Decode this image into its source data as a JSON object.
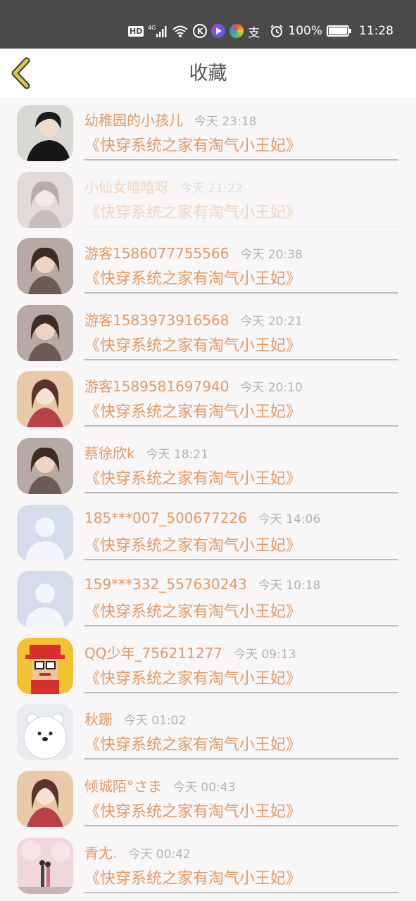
{
  "status_bar": {
    "hd": "HD",
    "network": "4G",
    "k_icon": "K",
    "alipay": "支",
    "battery_percent": "100%",
    "battery_level": 1.0,
    "time": "11:28"
  },
  "header": {
    "title": "收藏",
    "back_icon": "chevron-left-icon"
  },
  "colors": {
    "accent": "#e39a66",
    "header_bg": "#4a4a4a",
    "back_icon": "#e2c23f"
  },
  "favorites": [
    {
      "name": "幼稚园的小孩儿",
      "time": "今天 23:18",
      "book": "《快穿系统之家有淘气小王妃》",
      "avatar": "dark-hair-boy-avatar"
    },
    {
      "name": "小仙女嘻嘻呀",
      "time": "今天 21:22",
      "book": "《快穿系统之家有淘气小王妃》",
      "avatar": "girl-avatar"
    },
    {
      "name": "游客1586077755566",
      "time": "今天 20:38",
      "book": "《快穿系统之家有淘气小王妃》",
      "avatar": "girl-avatar"
    },
    {
      "name": "游客1583973916568",
      "time": "今天 20:21",
      "book": "《快穿系统之家有淘气小王妃》",
      "avatar": "girl-avatar"
    },
    {
      "name": "游客1589581697940",
      "time": "今天 20:10",
      "book": "《快穿系统之家有淘气小王妃》",
      "avatar": "anime-girl-avatar"
    },
    {
      "name": "蔡徐欣k",
      "time": "今天 18:21",
      "book": "《快穿系统之家有淘气小王妃》",
      "avatar": "girl-avatar"
    },
    {
      "name": "185***007_500677226",
      "time": "今天 14:06",
      "book": "《快穿系统之家有淘气小王妃》",
      "avatar": "default-user-avatar"
    },
    {
      "name": "159***332_557630243",
      "time": "今天 10:18",
      "book": "《快穿系统之家有淘气小王妃》",
      "avatar": "default-user-avatar"
    },
    {
      "name": "QQ少年_756211277",
      "time": "今天 09:13",
      "book": "《快穿系统之家有淘气小王妃》",
      "avatar": "qq-pixel-avatar"
    },
    {
      "name": "秋跚",
      "time": "今天 01:02",
      "book": "《快穿系统之家有淘气小王妃》",
      "avatar": "white-bear-avatar"
    },
    {
      "name": "倾城陌°さま",
      "time": "今天 00:43",
      "book": "《快穿系统之家有淘气小王妃》",
      "avatar": "anime-girl-avatar"
    },
    {
      "name": "青尢.",
      "time": "今天 00:42",
      "book": "《快穿系统之家有淘气小王妃》",
      "avatar": "couple-blossom-avatar"
    }
  ]
}
